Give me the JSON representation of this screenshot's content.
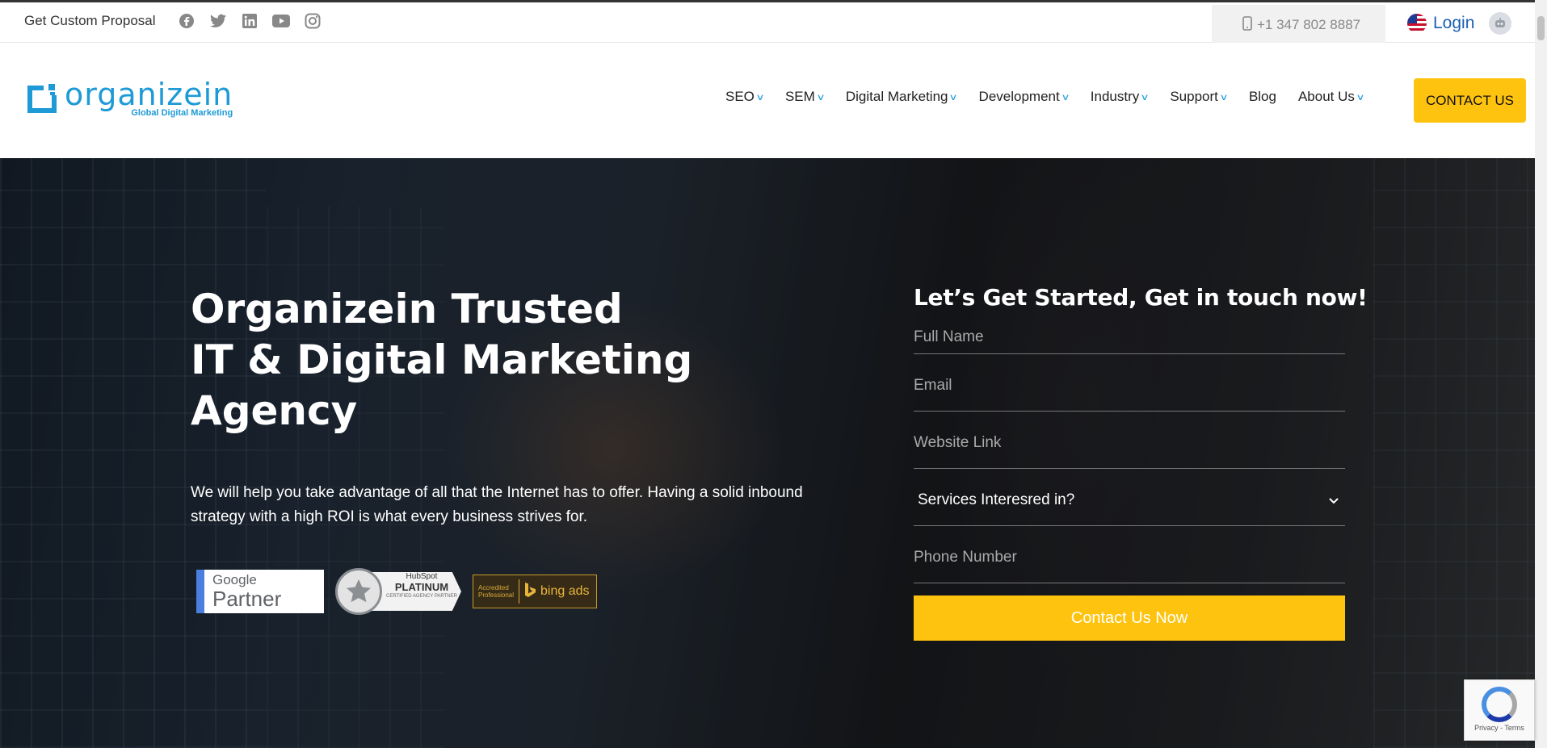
{
  "topbar": {
    "proposal": "Get Custom Proposal",
    "social": [
      "facebook-icon",
      "twitter-icon",
      "linkedin-icon",
      "youtube-icon",
      "instagram-icon"
    ],
    "phone": "+1 347 802 8887",
    "login": "Login"
  },
  "brand": {
    "name": "organizein",
    "tagline": "Global Digital Marketing",
    "color": "#1e9ad6"
  },
  "nav": {
    "items": [
      "SEO",
      "SEM",
      "Digital Marketing",
      "Development",
      "Industry",
      "Support",
      "Blog",
      "About Us"
    ],
    "contact": "CONTACT US"
  },
  "hero": {
    "line1": "Organizein Trusted",
    "line2": "IT & Digital Marketing",
    "line3": "Agency",
    "description": "We will help you take advantage of all that the Internet has to offer. Having a solid inbound strategy with a high ROI is what every business strives for.",
    "badges": {
      "google_top": "Google",
      "google_bottom": "Partner",
      "hubspot_top": "HubSpot",
      "hubspot_mid": "PLATINUM",
      "hubspot_bottom": "CERTIFIED AGENCY PARTNER",
      "bing_left": "Accredited Professional",
      "bing_right": "bing ads"
    }
  },
  "form": {
    "title": "Let’s Get Started, Get in touch now!",
    "full_name": "Full Name",
    "email": "Email",
    "website": "Website Link",
    "services": "Services Interesred in?",
    "phone": "Phone Number",
    "submit": "Contact Us Now"
  },
  "recaptcha": {
    "privacy": "Privacy - Terms"
  },
  "colors": {
    "accent": "#fec30f",
    "link": "#1a5fb4"
  }
}
